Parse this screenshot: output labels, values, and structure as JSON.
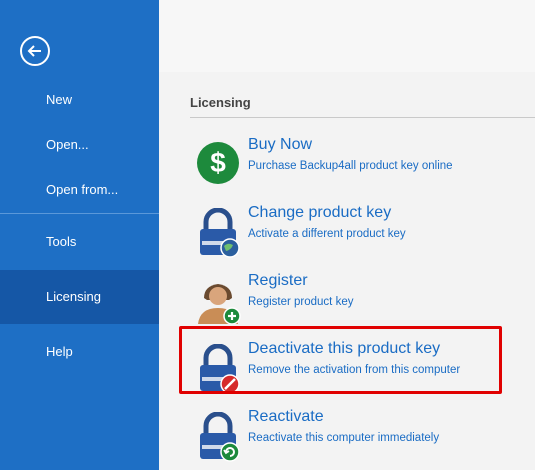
{
  "sidebar": {
    "items": [
      {
        "label": "New"
      },
      {
        "label": "Open..."
      },
      {
        "label": "Open from..."
      },
      {
        "label": "Tools"
      },
      {
        "label": "Licensing"
      },
      {
        "label": "Help"
      }
    ],
    "active": "Licensing"
  },
  "main": {
    "section_title": "Licensing",
    "options": [
      {
        "title": "Buy Now",
        "subtitle": "Purchase Backup4all product key online",
        "icon": "dollar-icon"
      },
      {
        "title": "Change product key",
        "subtitle": "Activate a different product key",
        "icon": "lock-globe-icon"
      },
      {
        "title": "Register",
        "subtitle": "Register product key",
        "icon": "user-add-icon"
      },
      {
        "title": "Deactivate this product key",
        "subtitle": "Remove the activation from this computer",
        "icon": "lock-remove-icon"
      },
      {
        "title": "Reactivate",
        "subtitle": "Reactivate this computer immediately",
        "icon": "lock-refresh-icon"
      }
    ]
  },
  "colors": {
    "sidebar_bg": "#1e6fc5",
    "sidebar_active": "#1557a6",
    "link_blue": "#1a6cc4",
    "highlight": "#e00000"
  }
}
